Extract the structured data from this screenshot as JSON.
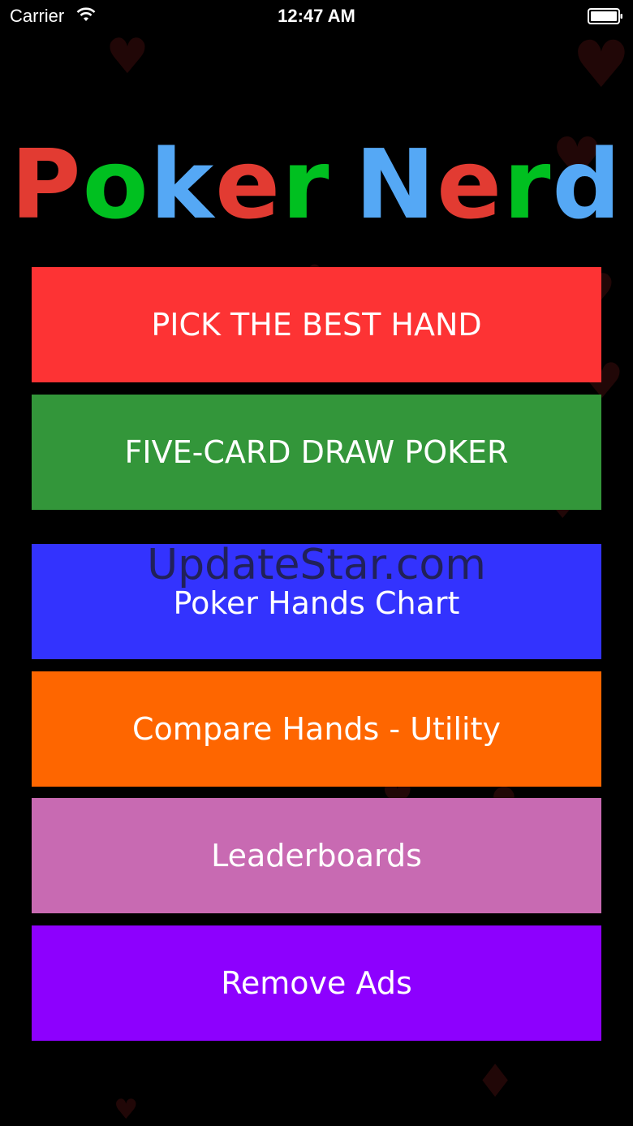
{
  "status_bar": {
    "carrier": "Carrier",
    "time": "12:47 AM"
  },
  "title": {
    "letters": [
      {
        "char": "P",
        "color": "#e23b32"
      },
      {
        "char": "o",
        "color": "#00c020"
      },
      {
        "char": "k",
        "color": "#55a8f5"
      },
      {
        "char": "e",
        "color": "#e23b32"
      },
      {
        "char": "r",
        "color": "#00c020"
      },
      {
        "char": " ",
        "color": "#ffffff"
      },
      {
        "char": "N",
        "color": "#55a8f5"
      },
      {
        "char": "e",
        "color": "#e23b32"
      },
      {
        "char": "r",
        "color": "#00c020"
      },
      {
        "char": "d",
        "color": "#55a8f5"
      }
    ]
  },
  "menu": {
    "pick_best_hand": {
      "label": "PICK THE BEST HAND",
      "color": "#fd3334"
    },
    "five_card_draw": {
      "label": "FIVE-CARD DRAW POKER",
      "color": "#33963a"
    },
    "hands_chart": {
      "label": "Poker Hands Chart",
      "color": "#3333fe"
    },
    "compare_hands": {
      "label": "Compare Hands - Utility",
      "color": "#fe6600"
    },
    "leaderboards": {
      "label": "Leaderboards",
      "color": "#c86ab2"
    },
    "remove_ads": {
      "label": "Remove Ads",
      "color": "#8d00fe"
    }
  },
  "watermark": "UpdateStar.com",
  "icons": {
    "wifi": "wifi-icon",
    "battery": "battery-icon"
  }
}
